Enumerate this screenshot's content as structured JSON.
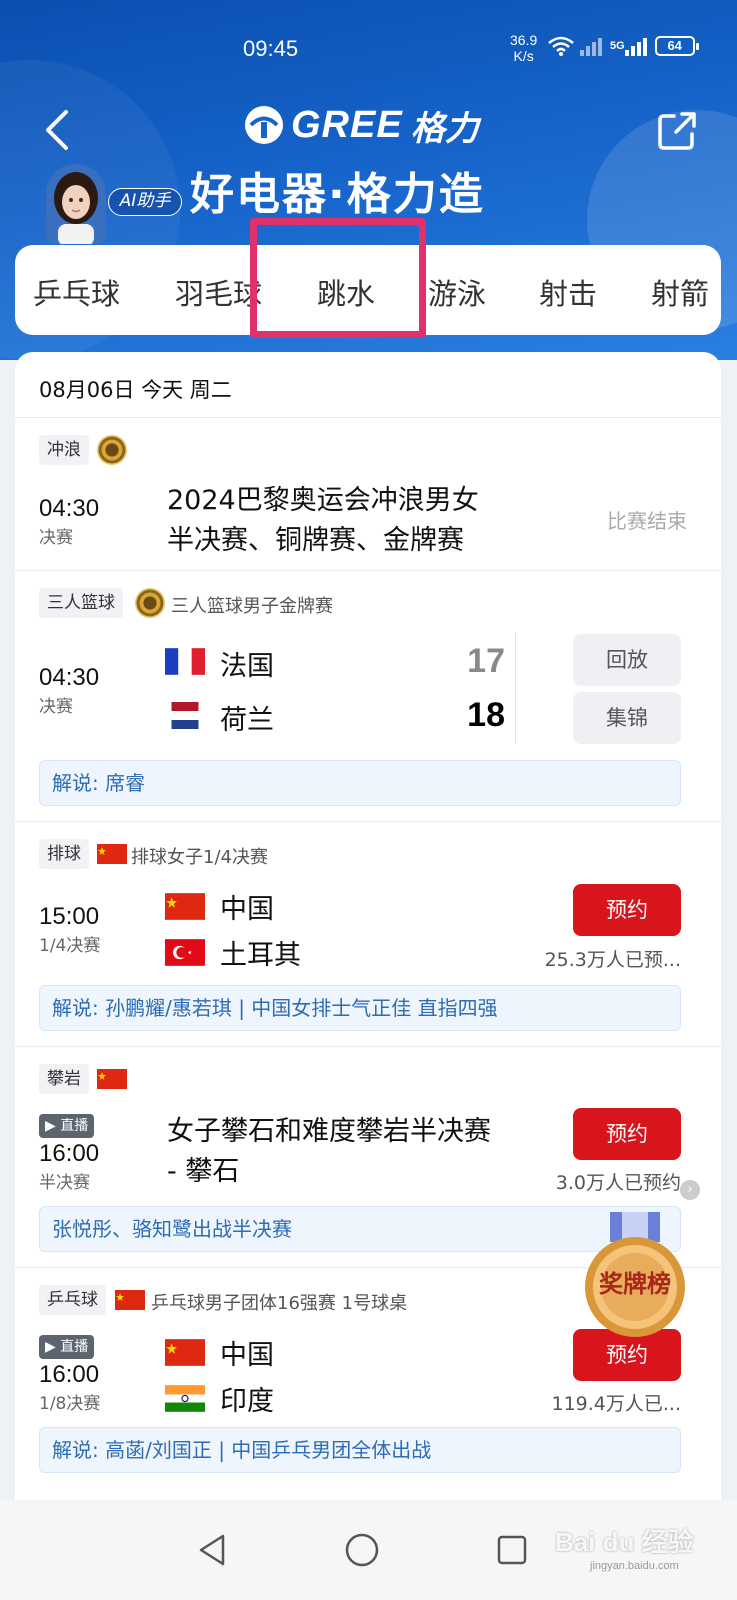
{
  "status_bar": {
    "time": "09:45",
    "net_speed": "36.9",
    "net_unit": "K/s",
    "signal": "5G",
    "battery": "64"
  },
  "header": {
    "brand_en": "GREE",
    "brand_cn": "格力",
    "slogan": "好电器·格力造",
    "ai_label": "AI助手"
  },
  "tabs": [
    "乒乓球",
    "羽毛球",
    "跳水",
    "游泳",
    "射击",
    "射箭"
  ],
  "date_bar": "08月06日 今天 周二",
  "matches": [
    {
      "tag": "冲浪",
      "time": "04:30",
      "stage": "决赛",
      "title_line1": "2024巴黎奥运会冲浪男女",
      "title_line2": "半决赛、铜牌赛、金牌赛",
      "status": "比赛结束"
    },
    {
      "tag": "三人篮球",
      "subtitle": "三人篮球男子金牌赛",
      "time": "04:30",
      "stage": "决赛",
      "team1": "法国",
      "score1": "17",
      "team2": "荷兰",
      "score2": "18",
      "btn1": "回放",
      "btn2": "集锦",
      "comment": "解说: 席睿"
    },
    {
      "tag": "排球",
      "subtitle": "排球女子1/4决赛",
      "time": "15:00",
      "stage": "1/4决赛",
      "team1": "中国",
      "team2": "土耳其",
      "button": "预约",
      "reserved": "25.3万人已预...",
      "comment": "解说: 孙鹏耀/惠若琪 | 中国女排士气正佳 直指四强"
    },
    {
      "tag": "攀岩",
      "live": "▶ 直播",
      "time": "16:00",
      "stage": "半决赛",
      "title_line1": "女子攀石和难度攀岩半决赛",
      "title_line2": "- 攀石",
      "button": "预约",
      "reserved": "3.0万人已预约",
      "comment": "张悦彤、骆知鹭出战半决赛"
    },
    {
      "tag": "乒乓球",
      "subtitle": "乒乓球男子团体16强赛 1号球桌",
      "live": "▶ 直播",
      "time": "16:00",
      "stage": "1/8决赛",
      "team1": "中国",
      "team2": "印度",
      "button": "预约",
      "reserved": "119.4万人已...",
      "comment": "解说: 高菡/刘国正 | 中国乒乓男团全体出战"
    }
  ],
  "medal_board": "奖牌榜",
  "watermark": {
    "main": "Bai du 经验",
    "sub": "jingyan.baidu.com"
  },
  "colors": {
    "header_blue": "#1663c9",
    "highlight": "#e0316d",
    "reserve_red": "#d8141c",
    "comment_blue": "#2e6cb5"
  }
}
